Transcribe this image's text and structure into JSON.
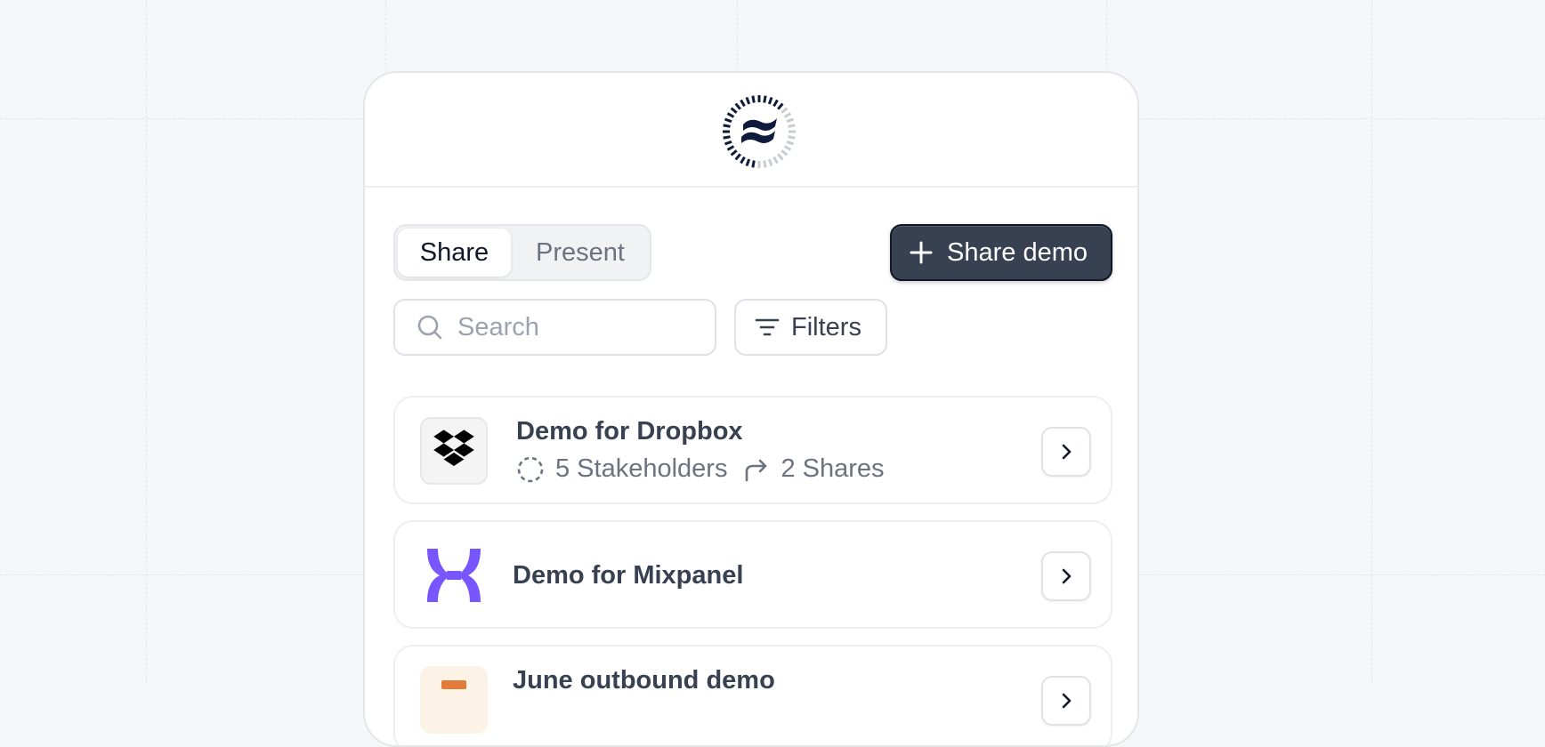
{
  "segmented": {
    "share_label": "Share",
    "present_label": "Present",
    "selected": "Share"
  },
  "actions": {
    "share_demo_label": "Share demo",
    "filters_label": "Filters"
  },
  "search": {
    "placeholder": "Search",
    "value": ""
  },
  "demos": [
    {
      "title": "Demo for Dropbox",
      "stakeholders": "5 Stakeholders",
      "shares": "2 Shares",
      "icon": "dropbox-logo"
    },
    {
      "title": "Demo for Mixpanel",
      "icon": "mixpanel-logo"
    },
    {
      "title": "June outbound demo",
      "icon": "june-logo"
    }
  ],
  "colors": {
    "primary_button": "#374151",
    "mixpanel_purple": "#7856ff",
    "background": "#f6f7f9"
  }
}
